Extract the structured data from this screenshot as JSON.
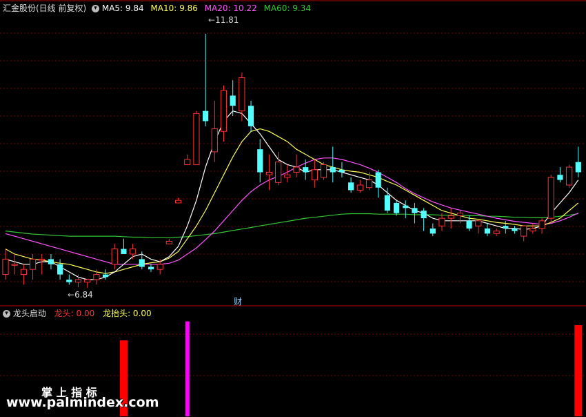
{
  "header": {
    "stock_name": "汇金股份(日线 前复权)",
    "ma5": "MA5: 9.84",
    "ma10": "MA10: 9.86",
    "ma20": "MA20: 10.22",
    "ma60": "MA60: 9.34"
  },
  "subheader": {
    "indicator_name": "龙头启动",
    "longtou": "龙头: 0.00",
    "longtaitou": "龙抬头: 0.00"
  },
  "annotations": {
    "high_label": "11.81",
    "low_label": "6.84",
    "cai_marker": "财"
  },
  "watermark": {
    "line1": "掌 上 指 标",
    "line2": "www.palmindex.com"
  },
  "colors": {
    "up": "#ff3232",
    "down": "#54ffff",
    "ma5": "#ffffff",
    "ma10": "#ffff54",
    "ma20": "#ff54ff",
    "ma60": "#32c832",
    "longtou": "#ff0000",
    "longtaitou": "#ff00ff",
    "grid": "#7a0000"
  },
  "chart_data": [
    {
      "type": "candlestick",
      "ylim": [
        6.5,
        12.2
      ],
      "high": 11.81,
      "low": 6.84,
      "candles": [
        [
          7.1,
          7.6,
          7.0,
          7.4
        ],
        [
          7.3,
          7.5,
          7.1,
          7.3
        ],
        [
          7.1,
          7.3,
          6.9,
          7.2
        ],
        [
          7.2,
          7.5,
          7.0,
          7.4
        ],
        [
          7.4,
          7.5,
          7.1,
          7.4
        ],
        [
          7.4,
          7.5,
          7.2,
          7.3
        ],
        [
          7.3,
          7.4,
          7.0,
          7.1
        ],
        [
          7.0,
          7.1,
          6.9,
          6.95
        ],
        [
          6.95,
          7.1,
          6.85,
          7.0
        ],
        [
          6.95,
          7.0,
          6.84,
          7.0
        ],
        [
          7.0,
          7.2,
          6.9,
          7.1
        ],
        [
          7.1,
          7.2,
          7.0,
          7.05
        ],
        [
          7.3,
          7.7,
          7.2,
          7.6
        ],
        [
          7.6,
          7.8,
          7.5,
          7.5
        ],
        [
          7.5,
          7.7,
          7.4,
          7.6
        ],
        [
          7.4,
          7.55,
          7.2,
          7.25
        ],
        [
          7.25,
          7.3,
          7.15,
          7.2
        ],
        [
          7.2,
          7.4,
          7.1,
          7.3
        ],
        [
          7.7,
          7.8,
          7.7,
          7.75
        ],
        [
          8.5,
          8.6,
          8.5,
          8.55
        ],
        [
          9.25,
          9.45,
          9.25,
          9.35
        ],
        [
          9.25,
          10.3,
          9.25,
          10.25
        ],
        [
          10.3,
          11.81,
          10.0,
          10.1
        ],
        [
          9.5,
          10.5,
          9.3,
          9.95
        ],
        [
          9.9,
          10.8,
          9.7,
          10.7
        ],
        [
          10.6,
          10.9,
          10.2,
          10.4
        ],
        [
          10.3,
          11.05,
          10.1,
          10.95
        ],
        [
          10.4,
          10.5,
          9.9,
          10.0
        ],
        [
          9.55,
          9.75,
          8.9,
          9.1
        ],
        [
          9.05,
          9.45,
          8.75,
          9.1
        ],
        [
          8.9,
          9.5,
          8.85,
          9.3
        ],
        [
          9.0,
          9.25,
          8.9,
          9.05
        ],
        [
          9.1,
          9.45,
          9.0,
          9.2
        ],
        [
          9.2,
          9.35,
          8.95,
          9.1
        ],
        [
          8.95,
          9.35,
          8.8,
          9.15
        ],
        [
          9.0,
          9.3,
          8.95,
          9.25
        ],
        [
          9.2,
          9.6,
          8.9,
          9.1
        ],
        [
          9.15,
          9.3,
          9.0,
          9.1
        ],
        [
          8.9,
          9.0,
          8.7,
          8.75
        ],
        [
          8.75,
          8.95,
          8.7,
          8.85
        ],
        [
          8.8,
          9.1,
          8.75,
          8.95
        ],
        [
          9.1,
          9.15,
          8.6,
          8.8
        ],
        [
          8.65,
          8.8,
          8.3,
          8.35
        ],
        [
          8.5,
          8.55,
          8.25,
          8.3
        ],
        [
          8.45,
          8.55,
          8.2,
          8.4
        ],
        [
          8.4,
          8.5,
          8.1,
          8.3
        ],
        [
          8.35,
          8.4,
          7.95,
          8.2
        ],
        [
          8.0,
          8.1,
          7.85,
          7.9
        ],
        [
          8.05,
          8.3,
          7.95,
          8.2
        ],
        [
          8.2,
          8.4,
          8.0,
          8.25
        ],
        [
          8.25,
          8.35,
          8.1,
          8.3
        ],
        [
          8.15,
          8.25,
          7.95,
          8.0
        ],
        [
          8.05,
          8.15,
          7.9,
          8.15
        ],
        [
          8.0,
          8.1,
          7.85,
          7.9
        ],
        [
          7.9,
          8.0,
          7.85,
          7.95
        ],
        [
          8.05,
          8.15,
          7.9,
          8.0
        ],
        [
          8.0,
          8.05,
          7.9,
          7.95
        ],
        [
          7.85,
          8.05,
          7.75,
          8.05
        ],
        [
          7.95,
          8.1,
          7.9,
          8.0
        ],
        [
          8.0,
          8.2,
          7.9,
          8.15
        ],
        [
          8.2,
          9.05,
          8.1,
          9.0
        ],
        [
          9.05,
          9.2,
          8.9,
          8.95
        ],
        [
          8.85,
          9.25,
          8.8,
          9.2
        ],
        [
          9.3,
          9.6,
          9.0,
          9.1
        ]
      ],
      "ma5": [
        7.4,
        7.35,
        7.3,
        7.3,
        7.35,
        7.35,
        7.25,
        7.15,
        7.05,
        7.0,
        7.0,
        7.05,
        7.15,
        7.3,
        7.45,
        7.5,
        7.4,
        7.35,
        7.45,
        7.65,
        8.05,
        8.55,
        9.2,
        9.7,
        10.1,
        10.3,
        10.25,
        10.05,
        9.85,
        9.6,
        9.35,
        9.25,
        9.2,
        9.1,
        9.15,
        9.15,
        9.15,
        9.1,
        9.05,
        9.0,
        8.95,
        8.85,
        8.7,
        8.55,
        8.45,
        8.35,
        8.3,
        8.2,
        8.15,
        8.15,
        8.15,
        8.15,
        8.15,
        8.1,
        8.05,
        8.0,
        8.0,
        7.98,
        8.0,
        8.05,
        8.3,
        8.5,
        8.7,
        8.95
      ],
      "ma10": [
        7.6,
        7.5,
        7.45,
        7.4,
        7.38,
        7.35,
        7.32,
        7.3,
        7.25,
        7.2,
        7.15,
        7.12,
        7.15,
        7.2,
        7.25,
        7.3,
        7.33,
        7.35,
        7.42,
        7.55,
        7.8,
        8.05,
        8.35,
        8.7,
        9.05,
        9.4,
        9.7,
        9.9,
        9.95,
        9.9,
        9.8,
        9.7,
        9.55,
        9.45,
        9.35,
        9.25,
        9.2,
        9.15,
        9.12,
        9.1,
        9.05,
        9.0,
        8.92,
        8.85,
        8.75,
        8.65,
        8.55,
        8.45,
        8.35,
        8.3,
        8.25,
        8.2,
        8.18,
        8.15,
        8.12,
        8.1,
        8.08,
        8.05,
        8.05,
        8.05,
        8.12,
        8.2,
        8.35,
        8.5
      ],
      "ma20": [
        7.9,
        7.85,
        7.8,
        7.75,
        7.7,
        7.65,
        7.6,
        7.55,
        7.5,
        7.45,
        7.4,
        7.35,
        7.3,
        7.3,
        7.3,
        7.3,
        7.3,
        7.3,
        7.32,
        7.38,
        7.5,
        7.62,
        7.78,
        7.95,
        8.15,
        8.35,
        8.55,
        8.72,
        8.85,
        8.95,
        9.02,
        9.1,
        9.2,
        9.28,
        9.35,
        9.38,
        9.38,
        9.35,
        9.3,
        9.25,
        9.18,
        9.1,
        9.0,
        8.9,
        8.78,
        8.68,
        8.6,
        8.52,
        8.46,
        8.4,
        8.36,
        8.32,
        8.28,
        8.24,
        8.2,
        8.17,
        8.14,
        8.12,
        8.1,
        8.08,
        8.1,
        8.15,
        8.22,
        8.3
      ],
      "ma60": [
        7.95,
        7.93,
        7.91,
        7.89,
        7.88,
        7.87,
        7.86,
        7.85,
        7.85,
        7.85,
        7.85,
        7.85,
        7.85,
        7.84,
        7.83,
        7.83,
        7.82,
        7.82,
        7.82,
        7.83,
        7.84,
        7.86,
        7.88,
        7.9,
        7.93,
        7.96,
        7.99,
        8.02,
        8.05,
        8.08,
        8.11,
        8.14,
        8.17,
        8.2,
        8.22,
        8.24,
        8.26,
        8.28,
        8.29,
        8.29,
        8.29,
        8.28,
        8.28,
        8.28,
        8.28,
        8.27,
        8.27,
        8.27,
        8.26,
        8.26,
        8.26,
        8.25,
        8.25,
        8.24,
        8.24,
        8.23,
        8.22,
        8.22,
        8.21,
        8.21,
        8.22,
        8.24,
        8.26,
        8.29
      ]
    },
    {
      "type": "bar",
      "title": "龙头启动",
      "series": [
        {
          "name": "龙头",
          "bars": [
            [
              13,
              1.0
            ],
            [
              63,
              1.2
            ]
          ]
        },
        {
          "name": "龙抬头",
          "bars": [
            [
              20,
              1.25
            ]
          ]
        }
      ],
      "ylim": [
        0,
        1.3
      ]
    }
  ]
}
